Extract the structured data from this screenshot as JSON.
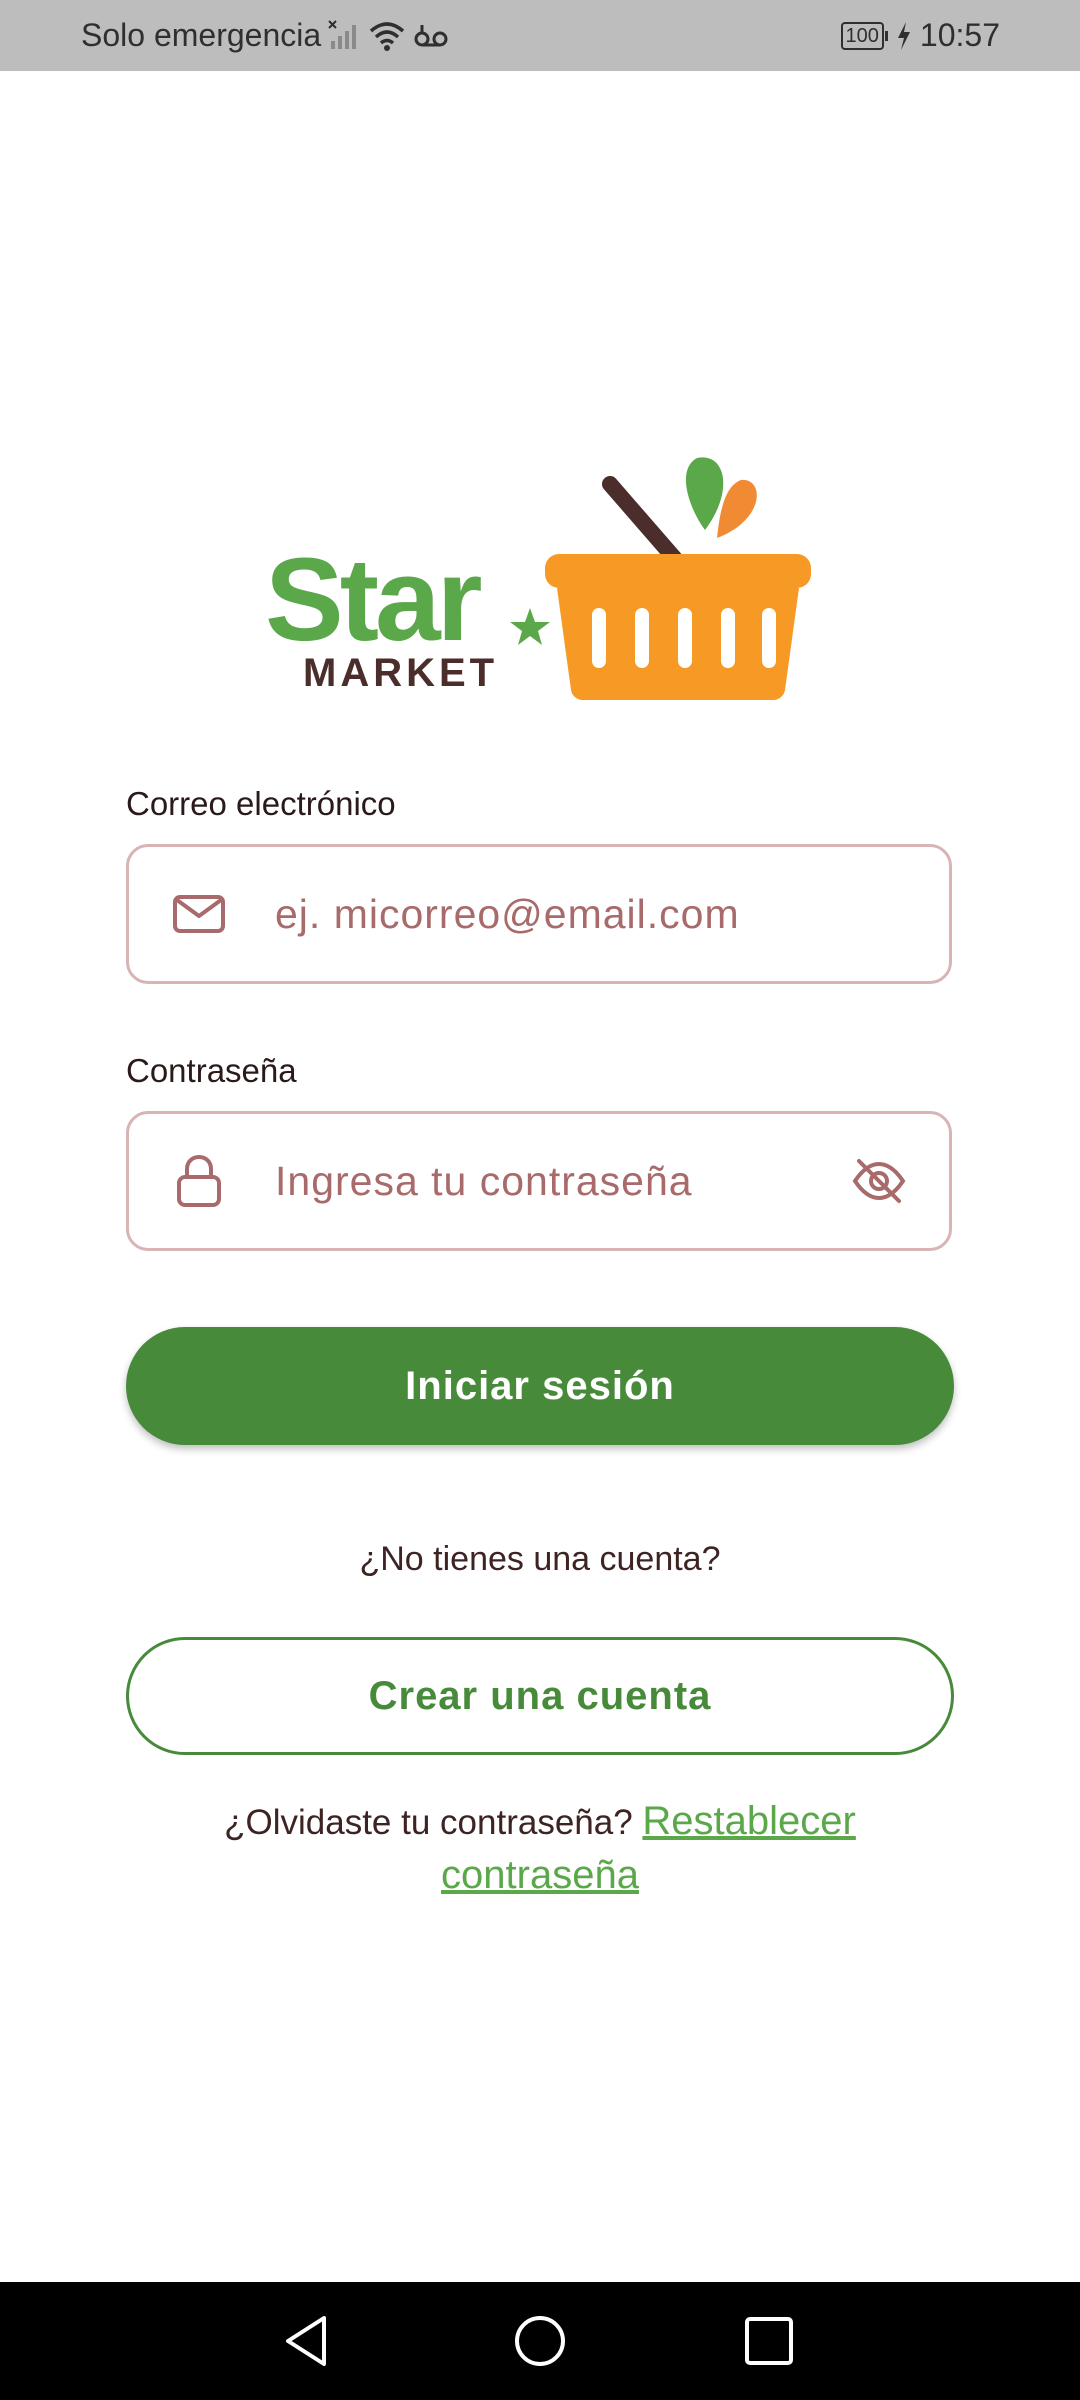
{
  "status_bar": {
    "carrier_text": "Solo emergencia",
    "battery_level": "100",
    "time": "10:57"
  },
  "logo": {
    "brand_word": "Star",
    "sub_word": "MARKET",
    "colors": {
      "green": "#5ba84a",
      "brown": "#4b2e2b",
      "orange": "#f79a25"
    }
  },
  "form": {
    "email": {
      "label": "Correo electrónico",
      "placeholder": "ej. micorreo@email.com",
      "value": "",
      "icon": "mail-icon"
    },
    "password": {
      "label": "Contraseña",
      "placeholder": "Ingresa tu contraseña",
      "value": "",
      "icon": "lock-icon",
      "visibility_icon": "eye-off-icon"
    },
    "login_button": "Iniciar sesión",
    "no_account_text": "¿No tienes una cuenta?",
    "create_account_button": "Crear una cuenta",
    "forgot_text": "¿Olvidaste tu contraseña?",
    "reset_link": "Restablecer contraseña"
  },
  "colors": {
    "primary": "#468a3a",
    "input_border": "#d8b4b4",
    "placeholder": "#a86a6a",
    "link": "#5ba84a"
  },
  "nav_bar": {
    "back_icon": "back-triangle-icon",
    "home_icon": "home-circle-icon",
    "recent_icon": "recent-square-icon"
  }
}
